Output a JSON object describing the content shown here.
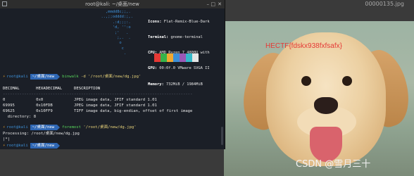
{
  "viewer": {
    "title": "00000135.jpg",
    "overlay_text": "HECTF{fdskx938fxfsafx}",
    "watermark": "CSDN @雪月三十"
  },
  "terminal": {
    "title": "root@kali: ~/桌面/new",
    "neofetch_logo": "        ,mmdd8c;;,.\n      ..,;;odddd:;,.\n           .:d;;;:.\n           'd, '':o\n            ;'   .\n             ;,.  .\n              o\n               c\n                .",
    "info": [
      {
        "k": "Icons",
        "v": "Flat-Remix-Blue-Dark"
      },
      {
        "k": "Terminal",
        "v": "gnome-terminal"
      },
      {
        "k": "CPU",
        "v": "AMD Ryzen 7 4800U with"
      },
      {
        "k": "GPU",
        "v": "00:0f.0 VMware SVGA II"
      },
      {
        "k": "Memory",
        "v": "732MiB / 1984MiB"
      }
    ],
    "swatch_colors": [
      "#1b1f27",
      "#e53935",
      "#35b34a",
      "#f0a830",
      "#3d8fd6",
      "#9b59b6",
      "#36b9c9",
      "#e6e6e6"
    ],
    "prompt_user": "root@kali",
    "prompt_path": "~/桌面/new",
    "cmd1": {
      "name": "binwalk",
      "args": " -d '/root/桌面/new/dg.jpg'"
    },
    "blank": "",
    "table_header": "DECIMAL       HEXADECIMAL     DESCRIPTION",
    "table_rule": "--------------------------------------------------------------------------------",
    "rows": [
      "0             0x0             JPEG image data, JFIF standard 1.01",
      "69995         0x10FDB         JPEG image data, JFIF standard 1.01",
      "69625         0x10FF9         TIFF image data, big-endian, offset of first image",
      "  directory: 8"
    ],
    "cmd2": {
      "name": "foremost",
      "args": " '/root/桌面/new/dg.jpg'"
    },
    "processing": "Processing: /root/桌面/new/dg.jpg",
    "progress": "|*|",
    "cursor": ""
  }
}
